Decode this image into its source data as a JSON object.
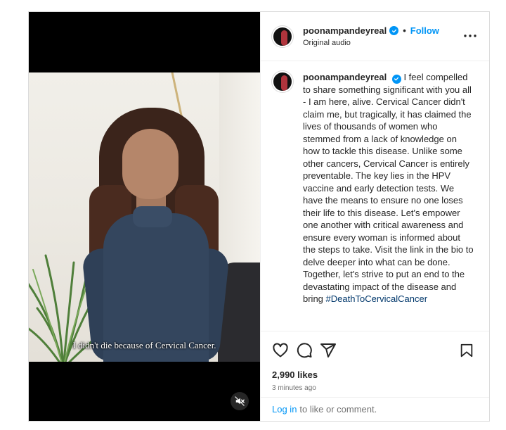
{
  "post": {
    "username": "poonampandeyreal",
    "follow_label": "Follow",
    "separator": "•",
    "audio_label": "Original audio",
    "caption_text": "I feel compelled to share something significant with you all - I am here, alive. Cervical Cancer didn't claim me, but tragically, it has claimed the lives of thousands of women who stemmed from a lack of knowledge on how to tackle this disease. Unlike some other cancers, Cervical Cancer is entirely preventable. The key lies in the HPV vaccine and early detection tests. We have the means to ensure no one loses their life to this disease. Let's empower one another with critical awareness and ensure every woman is informed about the steps to take. Visit the link in the bio to delve deeper into what can be done. Together, let's strive to put an end to the devastating impact of the disease and bring",
    "hashtag": "#DeathToCervicalCancer",
    "likes": "2,990 likes",
    "timestamp": "3 minutes ago",
    "login_link": "Log in",
    "login_suffix": "to like or comment."
  },
  "video": {
    "subtitle": "I didn't die because of Cervical Cancer.",
    "muted": true
  },
  "icons": {
    "more": "more-options-icon",
    "like": "heart-icon",
    "comment": "comment-icon",
    "share": "share-icon",
    "save": "bookmark-icon",
    "mute": "speaker-muted-icon",
    "verified": "verified-badge-icon"
  },
  "colors": {
    "accent": "#0095f6",
    "text": "#262626",
    "muted_text": "#737373",
    "hashtag": "#00376b",
    "border": "#dbdbdb"
  }
}
